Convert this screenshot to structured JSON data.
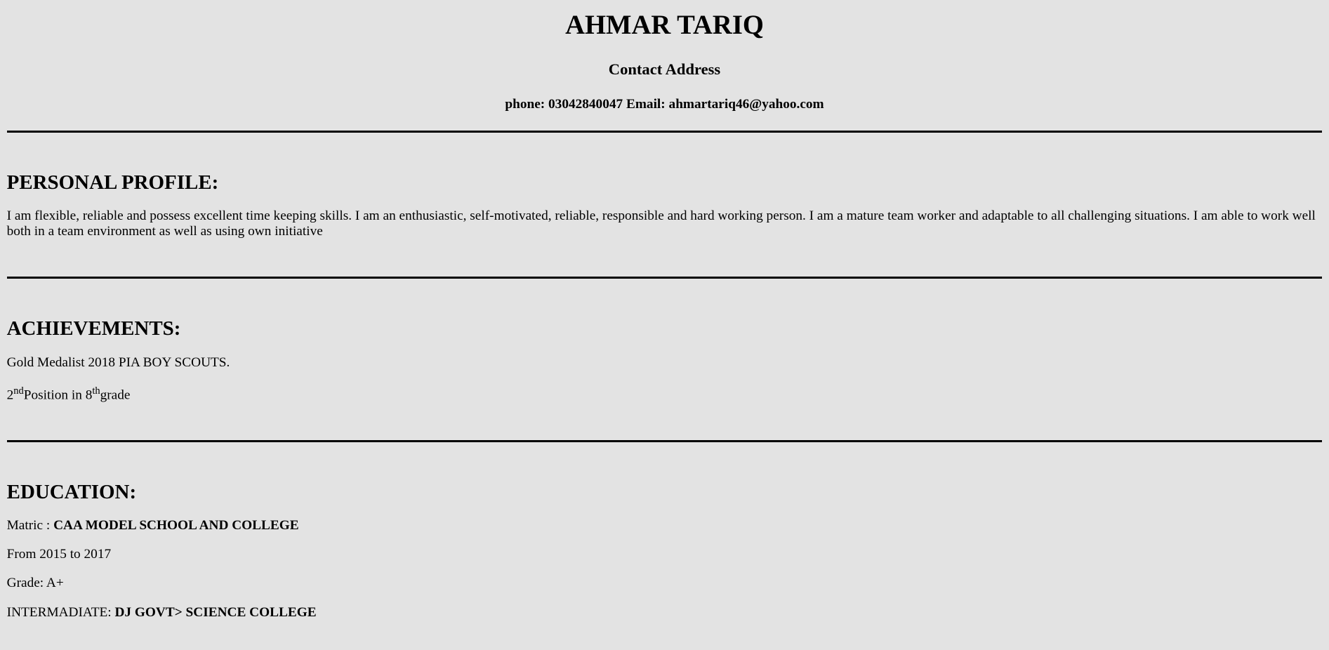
{
  "header": {
    "name": "AHMAR TARIQ",
    "contact_heading": "Contact Address",
    "contact_line": "phone: 03042840047 Email: ahmartariq46@yahoo.com"
  },
  "profile": {
    "heading": "PERSONAL PROFILE:",
    "text": "I am flexible, reliable and possess excellent time keeping skills. I am an enthusiastic, self-motivated, reliable, responsible and hard working person. I am a mature team worker and adaptable to all challenging situations. I am able to work well both in a team environment as well as using own initiative"
  },
  "achievements": {
    "heading": "ACHIEVEMENTS:",
    "item1": "Gold Medalist 2018 PIA BOY SCOUTS.",
    "item2": {
      "num1": "2",
      "sup1": "nd",
      "mid": "Position in 8",
      "sup2": "th",
      "end": "grade"
    }
  },
  "education": {
    "heading": "EDUCATION:",
    "matric_label": "Matric : ",
    "matric_school": "CAA MODEL SCHOOL AND COLLEGE",
    "matric_years": "From 2015 to 2017",
    "matric_grade": "Grade: A+",
    "inter_label": "INTERMADIATE: ",
    "inter_school": "DJ GOVT> SCIENCE COLLEGE"
  }
}
